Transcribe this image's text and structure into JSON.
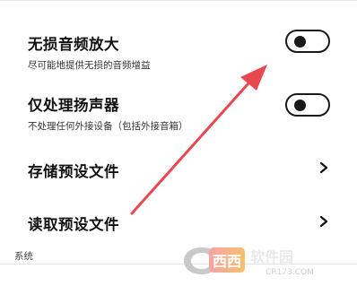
{
  "settings": {
    "lossless": {
      "title": "无损音频放大",
      "subtitle": "尽可能地提供无损的音频增益",
      "toggle_on": false
    },
    "speaker_only": {
      "title": "仅处理扬声器",
      "subtitle": "不处理任何外接设备（包括外接音箱）",
      "toggle_on": false
    },
    "save_preset": {
      "title": "存储预设文件"
    },
    "load_preset": {
      "title": "读取预设文件"
    }
  },
  "section": {
    "system": "系统"
  },
  "watermark": {
    "name": "西西软件园",
    "url": "CR173.COM"
  },
  "colors": {
    "annotation_arrow": "#e9474f",
    "toggle": "#1a1a1a"
  },
  "icons": {
    "chevron": "chevron-right-icon",
    "toggle_knob": "toggle-knob"
  }
}
